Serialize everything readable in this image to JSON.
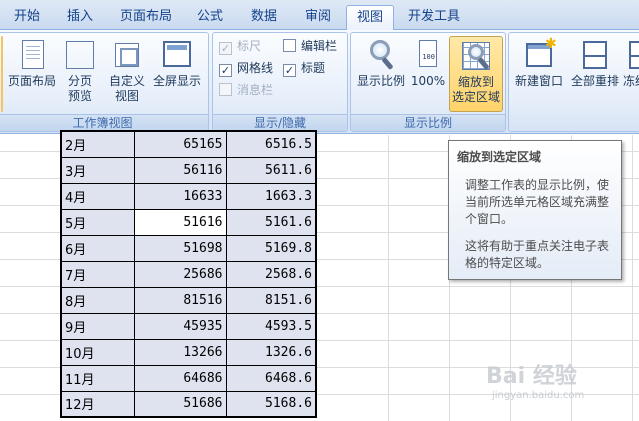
{
  "tabs": [
    "开始",
    "插入",
    "页面布局",
    "公式",
    "数据",
    "审阅",
    "视图",
    "开发工具"
  ],
  "active_tab": "视图",
  "groups": {
    "workbook_views": {
      "label": "工作簿视图",
      "buttons": [
        {
          "label1": "页面布局",
          "label2": ""
        },
        {
          "label1": "分页",
          "label2": "预览"
        },
        {
          "label1": "自定义",
          "label2": "视图"
        },
        {
          "label1": "全屏显示",
          "label2": ""
        }
      ]
    },
    "show_hide": {
      "label": "显示/隐藏",
      "checks": [
        {
          "label": "标尺",
          "checked": true,
          "disabled": true
        },
        {
          "label": "编辑栏",
          "checked": false,
          "disabled": false
        },
        {
          "label": "网格线",
          "checked": true,
          "disabled": false
        },
        {
          "label": "标题",
          "checked": true,
          "disabled": false
        },
        {
          "label": "消息栏",
          "checked": false,
          "disabled": true
        }
      ]
    },
    "zoom": {
      "label": "显示比例",
      "buttons": [
        {
          "label1": "显示比例",
          "label2": ""
        },
        {
          "label1": "100%",
          "label2": ""
        },
        {
          "label1": "缩放到",
          "label2": "选定区域"
        }
      ]
    },
    "window": {
      "buttons": [
        {
          "label1": "新建窗口"
        },
        {
          "label1": "全部重排"
        },
        {
          "label1": "冻结"
        }
      ]
    }
  },
  "tooltip": {
    "title": "缩放到选定区域",
    "body": "调整工作表的显示比例，使当前所选单元格区域充满整个窗口。",
    "body2": "这将有助于重点关注电子表格的特定区域。"
  },
  "table": {
    "rows": [
      {
        "month": "2月",
        "value": "65165",
        "pct": "6516.5"
      },
      {
        "month": "3月",
        "value": "56116",
        "pct": "5611.6"
      },
      {
        "month": "4月",
        "value": "16633",
        "pct": "1663.3"
      },
      {
        "month": "5月",
        "value": "51616",
        "pct": "5161.6"
      },
      {
        "month": "6月",
        "value": "51698",
        "pct": "5169.8"
      },
      {
        "month": "7月",
        "value": "25686",
        "pct": "2568.6"
      },
      {
        "month": "8月",
        "value": "81516",
        "pct": "8151.6"
      },
      {
        "month": "9月",
        "value": "45935",
        "pct": "4593.5"
      },
      {
        "month": "10月",
        "value": "13266",
        "pct": "1326.6"
      },
      {
        "month": "11月",
        "value": "64686",
        "pct": "6468.6"
      },
      {
        "month": "12月",
        "value": "51686",
        "pct": "5168.6"
      }
    ]
  },
  "watermark": {
    "logo": "Bai 经验",
    "url": "jingyan.baidu.com"
  }
}
